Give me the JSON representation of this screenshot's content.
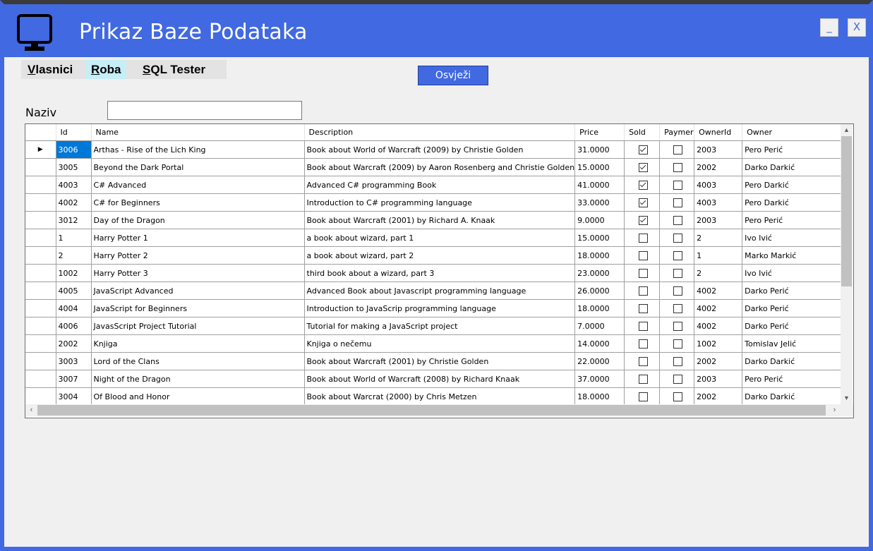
{
  "window": {
    "title": "Prikaz Baze Podataka",
    "minimize_label": "_",
    "close_label": "X",
    "accent_color": "#4169e1"
  },
  "menu": {
    "items": [
      {
        "hotkey": "V",
        "rest": "lasnici"
      },
      {
        "hotkey": "R",
        "rest": "oba"
      },
      {
        "hotkey": "S",
        "rest": "QL Tester"
      }
    ]
  },
  "toolbar": {
    "refresh_label": "Osvježi"
  },
  "filter": {
    "label": "Naziv",
    "value": ""
  },
  "grid": {
    "columns": [
      "Id",
      "Name",
      "Description",
      "Price",
      "Sold",
      "Paymer",
      "OwnerId",
      "Owner"
    ],
    "rows": [
      {
        "id": "3006",
        "name": "Arthas - Rise of the Lich King",
        "description": "Book about World of Warcraft (2009) by Christie Golden",
        "price": "31.0000",
        "sold": true,
        "payment": false,
        "owner_id": "2003",
        "owner": "Pero Perić"
      },
      {
        "id": "3005",
        "name": "Beyond the Dark Portal",
        "description": "Book about Warcraft (2009) by Aaron Rosenberg and Christie Golden",
        "price": "15.0000",
        "sold": true,
        "payment": false,
        "owner_id": "2002",
        "owner": "Darko Darkić"
      },
      {
        "id": "4003",
        "name": "C# Advanced",
        "description": "Advanced C# programming Book",
        "price": "41.0000",
        "sold": true,
        "payment": false,
        "owner_id": "4003",
        "owner": "Pero Darkić"
      },
      {
        "id": "4002",
        "name": "C# for Beginners",
        "description": "Introduction to C# programming language",
        "price": "33.0000",
        "sold": true,
        "payment": false,
        "owner_id": "4003",
        "owner": "Pero Darkić"
      },
      {
        "id": "3012",
        "name": "Day of the Dragon",
        "description": "Book about Warcraft (2001) by Richard A. Knaak",
        "price": "9.0000",
        "sold": true,
        "payment": false,
        "owner_id": "2003",
        "owner": "Pero Perić"
      },
      {
        "id": "1",
        "name": "Harry Potter 1",
        "description": "a book about wizard, part 1",
        "price": "15.0000",
        "sold": false,
        "payment": false,
        "owner_id": "2",
        "owner": "Ivo Ivić"
      },
      {
        "id": "2",
        "name": "Harry Potter 2",
        "description": "a book about wizard, part 2",
        "price": "18.0000",
        "sold": false,
        "payment": false,
        "owner_id": "1",
        "owner": "Marko Markić"
      },
      {
        "id": "1002",
        "name": "Harry Potter 3",
        "description": "third book about a wizard, part 3",
        "price": "23.0000",
        "sold": false,
        "payment": false,
        "owner_id": "2",
        "owner": "Ivo Ivić"
      },
      {
        "id": "4005",
        "name": "JavaScript Advanced",
        "description": "Advanced Book about Javascript programming language",
        "price": "26.0000",
        "sold": false,
        "payment": false,
        "owner_id": "4002",
        "owner": "Darko Perić"
      },
      {
        "id": "4004",
        "name": "JavaScript for Beginners",
        "description": "Introduction to JavaScrip programming language",
        "price": "18.0000",
        "sold": false,
        "payment": false,
        "owner_id": "4002",
        "owner": "Darko Perić"
      },
      {
        "id": "4006",
        "name": "JavasScript Project Tutorial",
        "description": "Tutorial for making a JavaScript project",
        "price": "7.0000",
        "sold": false,
        "payment": false,
        "owner_id": "4002",
        "owner": "Darko Perić"
      },
      {
        "id": "2002",
        "name": "Knjiga",
        "description": "Knjiga o nečemu",
        "price": "14.0000",
        "sold": false,
        "payment": false,
        "owner_id": "1002",
        "owner": "Tomislav Jelić"
      },
      {
        "id": "3003",
        "name": "Lord of the Clans",
        "description": "Book about Warcraft (2001) by Christie Golden",
        "price": "22.0000",
        "sold": false,
        "payment": false,
        "owner_id": "2002",
        "owner": "Darko Darkić"
      },
      {
        "id": "3007",
        "name": "Night of the Dragon",
        "description": "Book about World of Warcraft (2008) by Richard Knaak",
        "price": "37.0000",
        "sold": false,
        "payment": false,
        "owner_id": "2003",
        "owner": "Pero Perić"
      },
      {
        "id": "3004",
        "name": "Of Blood and Honor",
        "description": "Book about Warcrat (2000) by Chris Metzen",
        "price": "18.0000",
        "sold": false,
        "payment": false,
        "owner_id": "2002",
        "owner": "Darko Darkić"
      }
    ]
  }
}
